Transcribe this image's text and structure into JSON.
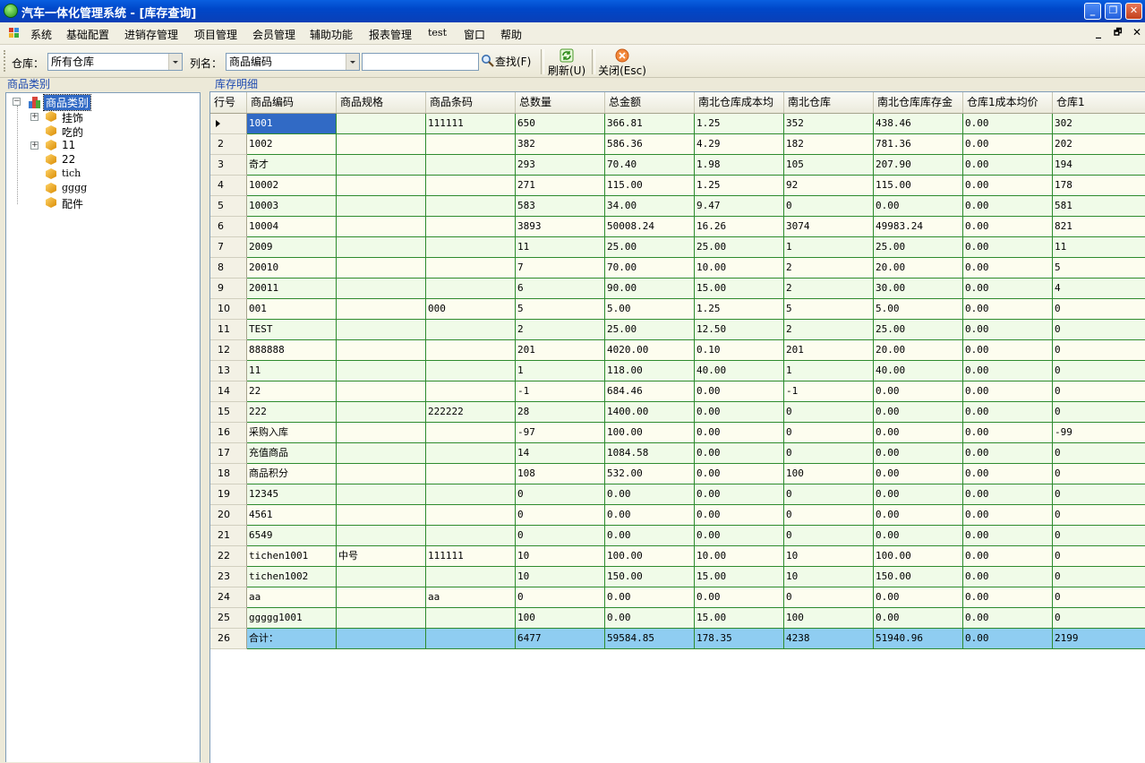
{
  "window": {
    "title": "汽车一体化管理系统 - [库存查询]",
    "buttons": [
      "_",
      "❐",
      "✕"
    ]
  },
  "menubar": {
    "items": [
      "系统",
      "基础配置",
      "进销存管理",
      "项目管理",
      "会员管理",
      "辅助功能",
      "报表管理",
      "test",
      "窗口",
      "帮助"
    ],
    "mdi_buttons": [
      "_",
      "🗗",
      "✕"
    ]
  },
  "toolbar": {
    "warehouse_label": "仓库：",
    "warehouse_value": "所有仓库",
    "column_label": "列名：",
    "column_value": "商品编码",
    "search_value": "",
    "find_label": "查找(F)",
    "refresh_label": "刷新(U)",
    "close_label": "关闭(Esc)"
  },
  "left_panel": {
    "caption": "商品类别",
    "root": "商品类别",
    "items": [
      {
        "label": "挂饰",
        "expandable": true
      },
      {
        "label": "吃的",
        "expandable": false
      },
      {
        "label": "11",
        "expandable": true
      },
      {
        "label": "22",
        "expandable": false
      },
      {
        "label": "tich",
        "expandable": false
      },
      {
        "label": "gggg",
        "expandable": false
      },
      {
        "label": "配件",
        "expandable": false
      }
    ]
  },
  "grid": {
    "caption": "库存明细",
    "row_header_label": "行号",
    "columns": [
      "商品编码",
      "商品规格",
      "商品条码",
      "总数量",
      "总金额",
      "南北仓库成本均",
      "南北仓库",
      "南北仓库库存金",
      "仓库1成本均价",
      "仓库1"
    ],
    "rows": [
      [
        "1",
        "1001",
        "",
        "111111",
        "650",
        "366.81",
        "1.25",
        "352",
        "438.46",
        "0.00",
        "302"
      ],
      [
        "2",
        "1002",
        "",
        "",
        "382",
        "586.36",
        "4.29",
        "182",
        "781.36",
        "0.00",
        "202"
      ],
      [
        "3",
        "奇才",
        "",
        "",
        "293",
        "70.40",
        "1.98",
        "105",
        "207.90",
        "0.00",
        "194"
      ],
      [
        "4",
        "10002",
        "",
        "",
        "271",
        "115.00",
        "1.25",
        "92",
        "115.00",
        "0.00",
        "178"
      ],
      [
        "5",
        "10003",
        "",
        "",
        "583",
        "34.00",
        "9.47",
        "0",
        "0.00",
        "0.00",
        "581"
      ],
      [
        "6",
        "10004",
        "",
        "",
        "3893",
        "50008.24",
        "16.26",
        "3074",
        "49983.24",
        "0.00",
        "821"
      ],
      [
        "7",
        "2009",
        "",
        "",
        "11",
        "25.00",
        "25.00",
        "1",
        "25.00",
        "0.00",
        "11"
      ],
      [
        "8",
        "20010",
        "",
        "",
        "7",
        "70.00",
        "10.00",
        "2",
        "20.00",
        "0.00",
        "5"
      ],
      [
        "9",
        "20011",
        "",
        "",
        "6",
        "90.00",
        "15.00",
        "2",
        "30.00",
        "0.00",
        "4"
      ],
      [
        "10",
        "001",
        "",
        "000",
        "5",
        "5.00",
        "1.25",
        "5",
        "5.00",
        "0.00",
        "0"
      ],
      [
        "11",
        "TEST",
        "",
        "",
        "2",
        "25.00",
        "12.50",
        "2",
        "25.00",
        "0.00",
        "0"
      ],
      [
        "12",
        "888888",
        "",
        "",
        "201",
        "4020.00",
        "0.10",
        "201",
        "20.00",
        "0.00",
        "0"
      ],
      [
        "13",
        "11",
        "",
        "",
        "1",
        "118.00",
        "40.00",
        "1",
        "40.00",
        "0.00",
        "0"
      ],
      [
        "14",
        "22",
        "",
        "",
        "-1",
        "684.46",
        "0.00",
        "-1",
        "0.00",
        "0.00",
        "0"
      ],
      [
        "15",
        "222",
        "",
        "222222",
        "28",
        "1400.00",
        "0.00",
        "0",
        "0.00",
        "0.00",
        "0"
      ],
      [
        "16",
        "采购入库",
        "",
        "",
        "-97",
        "100.00",
        "0.00",
        "0",
        "0.00",
        "0.00",
        "-99"
      ],
      [
        "17",
        "充值商品",
        "",
        "",
        "14",
        "1084.58",
        "0.00",
        "0",
        "0.00",
        "0.00",
        "0"
      ],
      [
        "18",
        "商品积分",
        "",
        "",
        "108",
        "532.00",
        "0.00",
        "100",
        "0.00",
        "0.00",
        "0"
      ],
      [
        "19",
        "12345",
        "",
        "",
        "0",
        "0.00",
        "0.00",
        "0",
        "0.00",
        "0.00",
        "0"
      ],
      [
        "20",
        "4561",
        "",
        "",
        "0",
        "0.00",
        "0.00",
        "0",
        "0.00",
        "0.00",
        "0"
      ],
      [
        "21",
        "6549",
        "",
        "",
        "0",
        "0.00",
        "0.00",
        "0",
        "0.00",
        "0.00",
        "0"
      ],
      [
        "22",
        "tichen1001",
        "中号",
        "111111",
        "10",
        "100.00",
        "10.00",
        "10",
        "100.00",
        "0.00",
        "0"
      ],
      [
        "23",
        "tichen1002",
        "",
        "",
        "10",
        "150.00",
        "15.00",
        "10",
        "150.00",
        "0.00",
        "0"
      ],
      [
        "24",
        "aa",
        "",
        "aa",
        "0",
        "0.00",
        "0.00",
        "0",
        "0.00",
        "0.00",
        "0"
      ],
      [
        "25",
        "ggggg1001",
        "",
        "",
        "100",
        "0.00",
        "15.00",
        "100",
        "0.00",
        "0.00",
        "0"
      ]
    ],
    "total_row": [
      "26",
      "合计：",
      "",
      "",
      "6477",
      "59584.85",
      "178.35",
      "4238",
      "51940.96",
      "0.00",
      "2199"
    ]
  },
  "colors": {
    "title_bar": "#0047c9",
    "grid_line": "#2e8b2e",
    "row_tint": "#f0fbe8",
    "total_row": "#8fcdf1",
    "selection": "#316ac5"
  }
}
